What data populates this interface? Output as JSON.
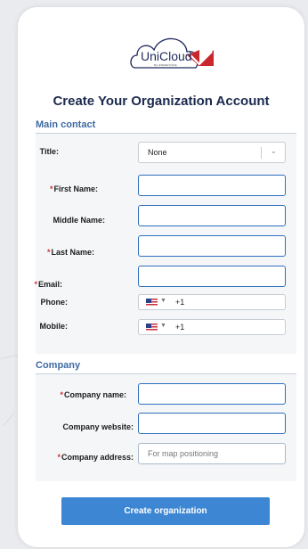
{
  "logo": {
    "brand": "UniCloud",
    "tagline": "By UNIFIEDVOICE"
  },
  "page_title": "Create Your Organization Account",
  "main_contact": {
    "section_title": "Main contact",
    "title_label": "Title:",
    "title_value": "None",
    "first_name_label": "First Name:",
    "middle_name_label": "Middle Name:",
    "last_name_label": "Last Name:",
    "email_label": "Email:",
    "phone_label": "Phone:",
    "phone_dial": "+1",
    "mobile_label": "Mobile:",
    "mobile_dial": "+1",
    "required_marker": "*"
  },
  "company": {
    "section_title": "Company",
    "name_label": "Company name:",
    "website_label": "Company website:",
    "address_label": "Company address:",
    "address_placeholder": "For map positioning"
  },
  "submit_label": "Create organization",
  "colors": {
    "accent": "#3c86d4",
    "section_title": "#3f6aa3",
    "required": "#d23434",
    "title_text": "#1b2a4e"
  }
}
